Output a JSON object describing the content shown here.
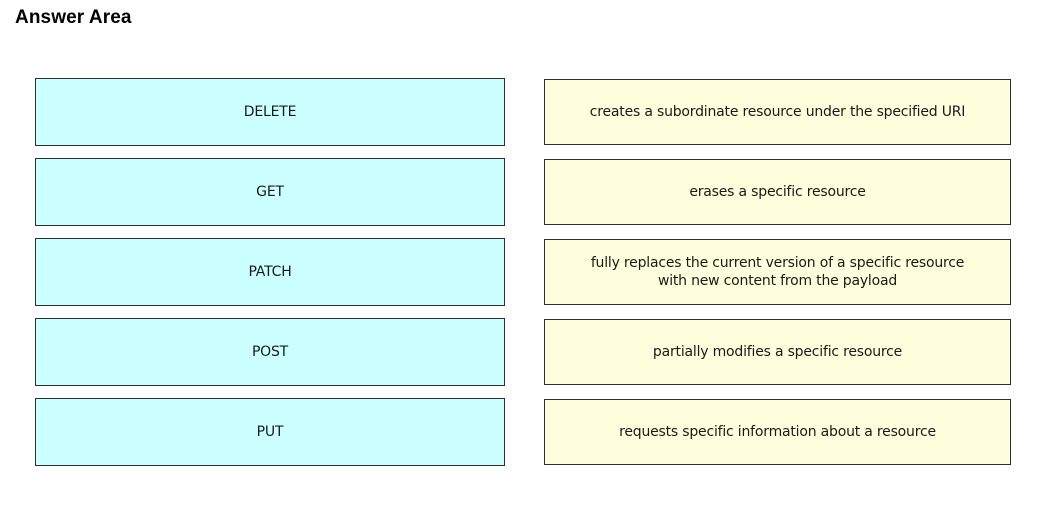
{
  "title": "Answer Area",
  "methods": [
    "DELETE",
    "GET",
    "PATCH",
    "POST",
    "PUT"
  ],
  "descriptions": [
    "creates a subordinate resource under the specified URI",
    "erases a specific resource",
    "fully replaces the current version of a specific resource\nwith new content from the payload",
    "partially modifies a specific resource",
    "requests specific information about a resource"
  ],
  "colors": {
    "method_box_bg": "#ccffff",
    "description_box_bg": "#ffffdd",
    "border": "#2e2e2e"
  }
}
